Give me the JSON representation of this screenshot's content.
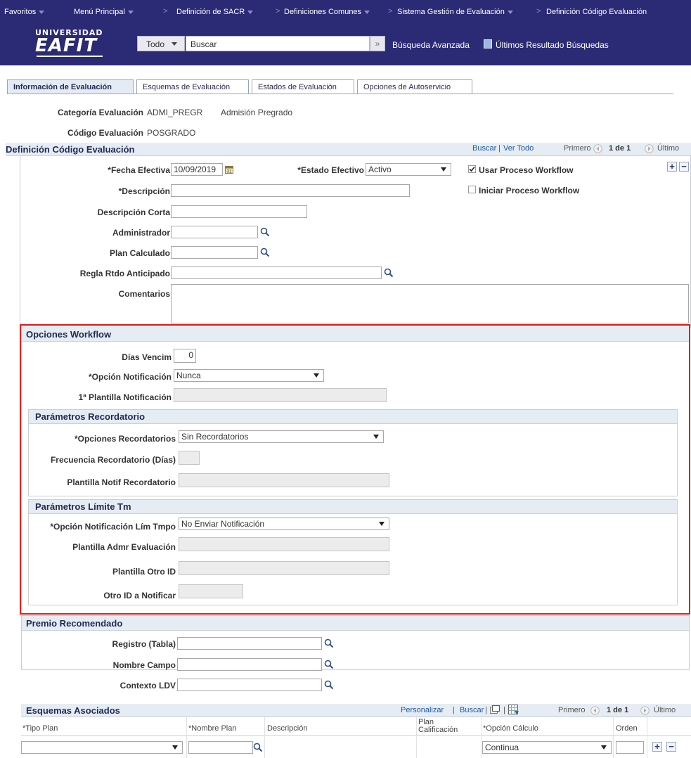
{
  "topnav": {
    "favorites": "Favoritos",
    "main_menu": "Menú Principal",
    "crumbs": [
      "Definición de SACR",
      "Definiciones Comunes",
      "Sistema Gestión de Evaluación",
      "Definición Código Evaluación"
    ]
  },
  "header": {
    "logo_top": "UNIVERSIDAD",
    "logo_main": "EAFIT",
    "scope": "Todo",
    "search_placeholder": "Buscar",
    "advanced_search": "Búsqueda Avanzada",
    "last_results": "Últimos Resultado Búsquedas"
  },
  "tabs": [
    "Información de Evaluación",
    "Esquemas de Evaluación",
    "Estados de Evaluación",
    "Opciones de Autoservicio"
  ],
  "info": {
    "category_label": "Categoría Evaluación",
    "category_value": "ADMI_PREGR",
    "category_desc": "Admisión Pregrado",
    "code_label": "Código Evaluación",
    "code_value": "POSGRADO"
  },
  "definition": {
    "title": "Definición Código Evaluación",
    "find": "Buscar",
    "view_all": "Ver Todo",
    "first": "Primero",
    "count": "1 de 1",
    "last": "Último",
    "effective_date_label": "*Fecha Efectiva",
    "effective_date_value": "10/09/2019",
    "status_label": "*Estado Efectivo",
    "status_value": "Activo",
    "use_workflow_label": "Usar Proceso Workflow",
    "start_workflow_label": "Iniciar Proceso Workflow",
    "description_label": "*Descripción",
    "short_desc_label": "Descripción Corta",
    "admin_label": "Administrador",
    "calc_plan_label": "Plan Calculado",
    "early_rule_label": "Regla Rtdo Anticipado",
    "comments_label": "Comentarios"
  },
  "workflow": {
    "title": "Opciones Workflow",
    "days_label": "Días Vencim",
    "days_value": "0",
    "notif_option_label": "*Opción Notificación",
    "notif_option_value": "Nunca",
    "template1_label": "1ª Plantilla Notificación",
    "reminder": {
      "title": "Parámetros Recordatorio",
      "options_label": "*Opciones Recordatorios",
      "options_value": "Sin Recordatorios",
      "freq_label": "Frecuencia Recordatorio (Días)",
      "template_label": "Plantilla Notif Recordatorio"
    },
    "limit": {
      "title": "Parámetros Límite Tm",
      "option_label": "*Opción Notificación Lím Tmpo",
      "option_value": "No Enviar Notificación",
      "admin_template_label": "Plantilla Admr Evaluación",
      "other_template_label": "Plantilla Otro ID",
      "other_id_label": "Otro ID a Notificar"
    }
  },
  "award": {
    "title": "Premio Recomendado",
    "record_label": "Registro (Tabla)",
    "field_label": "Nombre Campo",
    "context_label": "Contexto LDV"
  },
  "schemes": {
    "title": "Esquemas Asociados",
    "customize": "Personalizar",
    "find": "Buscar",
    "first": "Primero",
    "count": "1 de 1",
    "last": "Último",
    "col_plan_type": "*Tipo Plan",
    "col_plan_name": "*Nombre Plan",
    "col_description": "Descripción",
    "col_grade_plan": "Plan Calificación",
    "col_calc_option": "*Opción Cálculo",
    "col_order": "Orden",
    "calc_value": "Continua"
  },
  "colors": {
    "nav_bg": "#2b2a75",
    "section_bg": "#e6ecf3",
    "highlight": "#e02020",
    "link": "#1a5aa8"
  }
}
